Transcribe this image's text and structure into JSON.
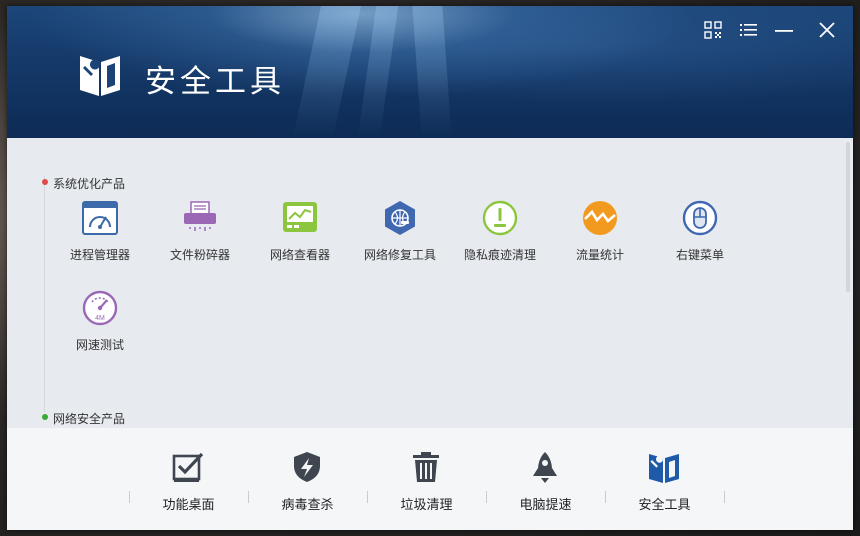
{
  "app": {
    "title": "安全工具"
  },
  "sections": [
    {
      "title": "系统优化产品",
      "dot_color": "#e24a4a",
      "items": [
        {
          "label": "进程管理器",
          "icon": "process-manager-icon",
          "color": "#3d6aa8"
        },
        {
          "label": "文件粉碎器",
          "icon": "file-shredder-icon",
          "color": "#9b68b6"
        },
        {
          "label": "网络查看器",
          "icon": "network-monitor-icon",
          "color": "#8cc63f"
        },
        {
          "label": "网络修复工具",
          "icon": "network-repair-icon",
          "color": "#3f68b1"
        },
        {
          "label": "隐私痕迹清理",
          "icon": "privacy-clean-icon",
          "color": "#8cc63f"
        },
        {
          "label": "流量统计",
          "icon": "traffic-stats-icon",
          "color": "#f29a1f"
        },
        {
          "label": "右键菜单",
          "icon": "mouse-icon",
          "color": "#3f68b1"
        },
        {
          "label": "网速测试",
          "icon": "speed-test-icon",
          "color": "#9b68b6",
          "badge": "4M"
        }
      ]
    },
    {
      "title": "网络安全产品",
      "dot_color": "#3aaa35",
      "items": []
    }
  ],
  "bottom_tabs": [
    {
      "label": "功能桌面",
      "icon": "checkbox-icon"
    },
    {
      "label": "病毒查杀",
      "icon": "shield-bolt-icon"
    },
    {
      "label": "垃圾清理",
      "icon": "trash-icon"
    },
    {
      "label": "电脑提速",
      "icon": "rocket-icon"
    },
    {
      "label": "安全工具",
      "icon": "security-tool-icon",
      "active": true
    }
  ],
  "colors": {
    "header_bg": "#153a6a",
    "active_tab": "#1e5aa8",
    "icon_gray": "#3f4650"
  }
}
